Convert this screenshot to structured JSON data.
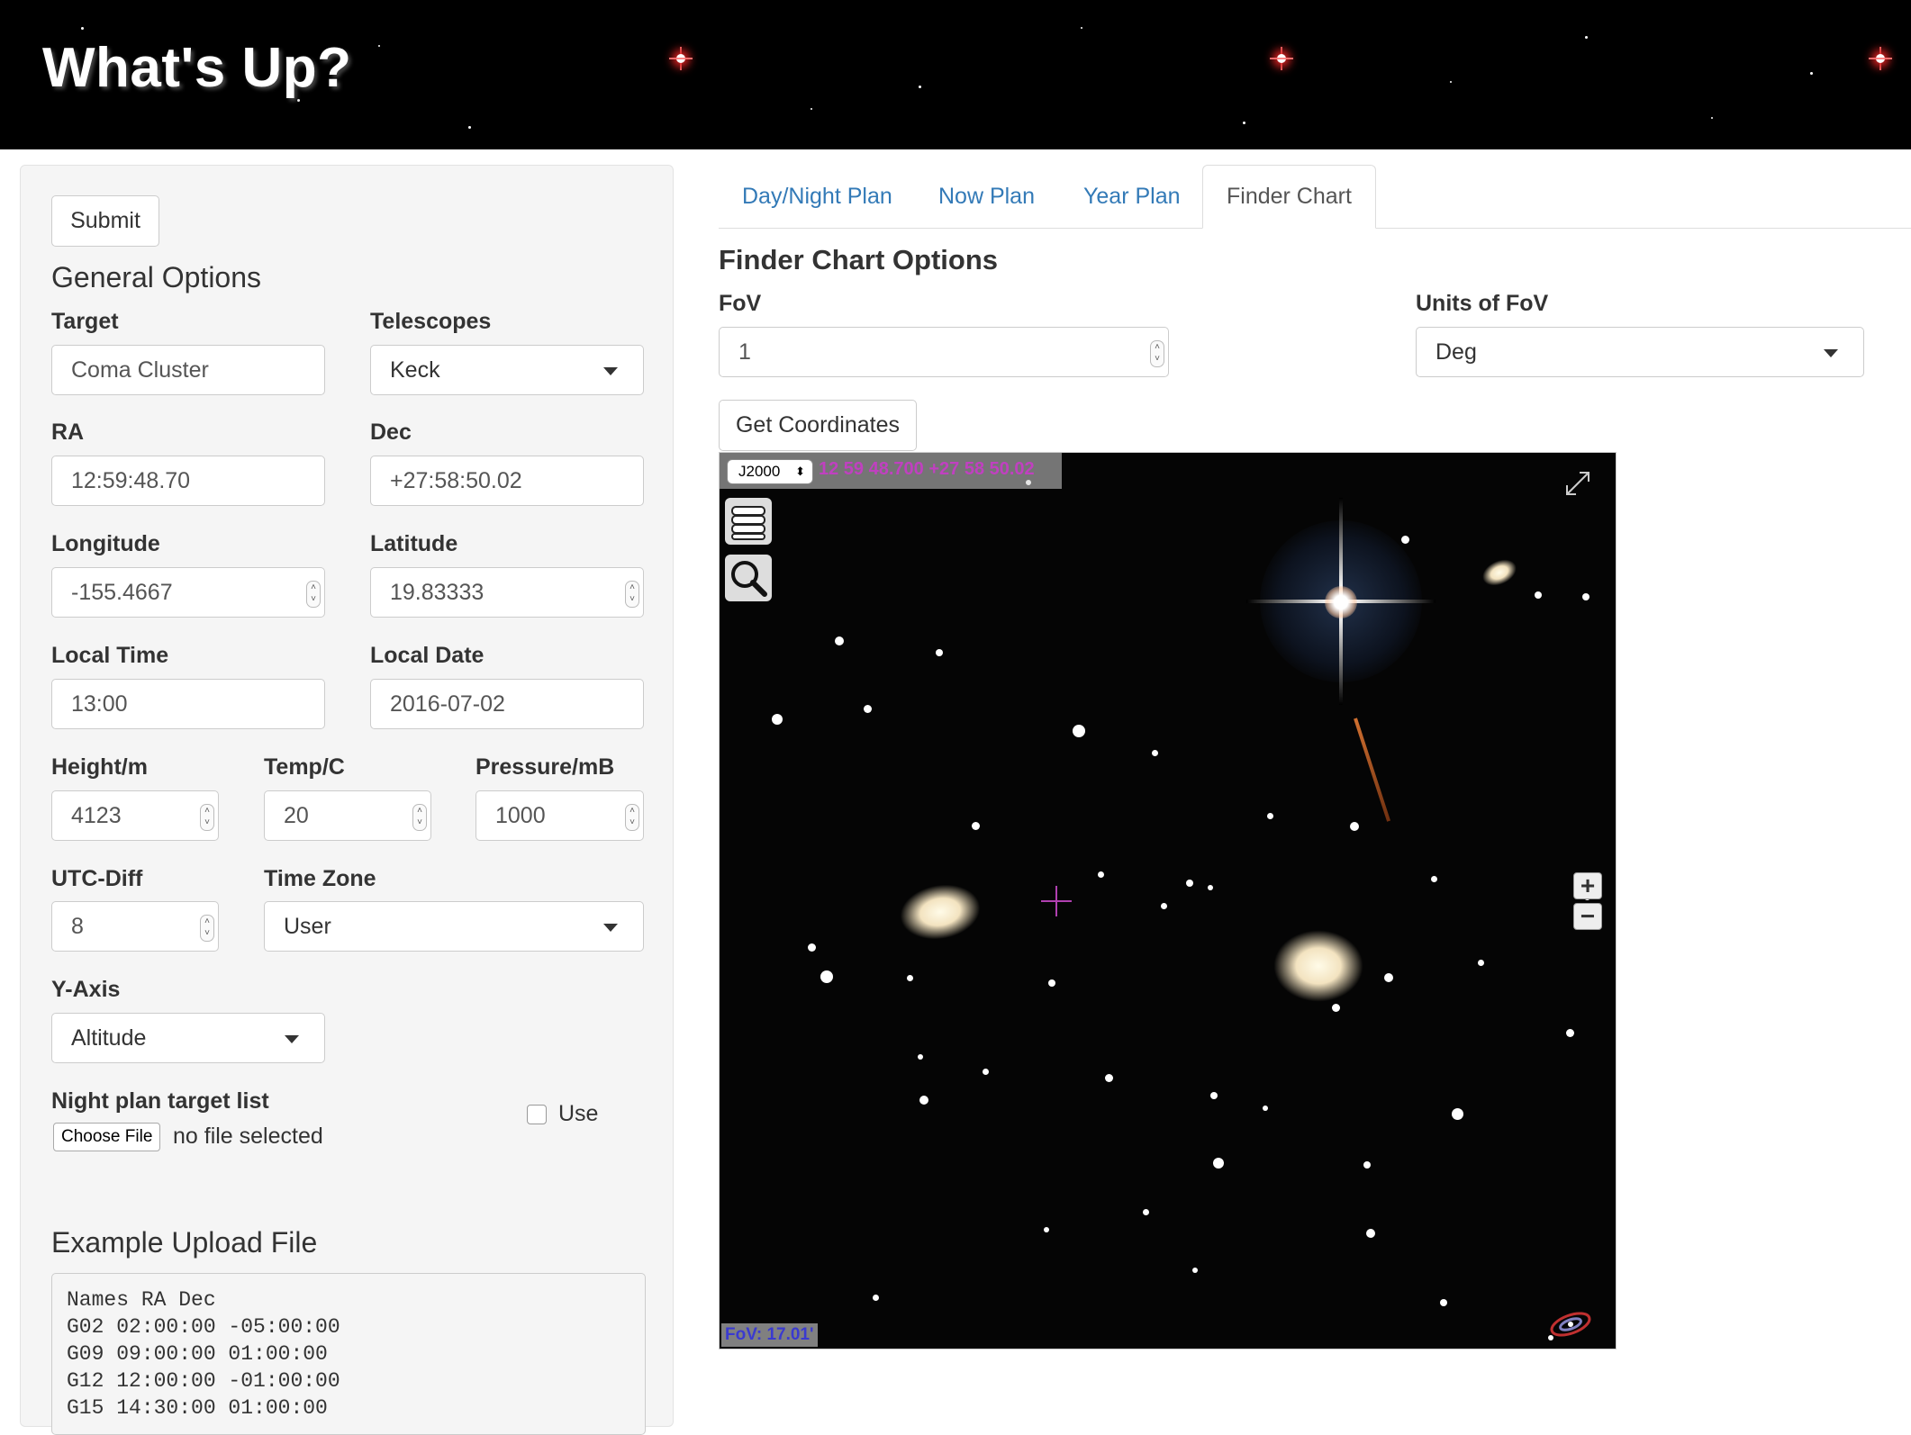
{
  "header": {
    "title": "What's Up?"
  },
  "sidebar": {
    "submit_label": "Submit",
    "general_options_heading": "General Options",
    "target": {
      "label": "Target",
      "value": "Coma Cluster"
    },
    "telescopes": {
      "label": "Telescopes",
      "value": "Keck"
    },
    "ra": {
      "label": "RA",
      "value": "12:59:48.70"
    },
    "dec": {
      "label": "Dec",
      "value": "+27:58:50.02"
    },
    "longitude": {
      "label": "Longitude",
      "value": "-155.4667"
    },
    "latitude": {
      "label": "Latitude",
      "value": "19.83333"
    },
    "local_time": {
      "label": "Local Time",
      "value": "13:00"
    },
    "local_date": {
      "label": "Local Date",
      "value": "2016-07-02"
    },
    "height": {
      "label": "Height/m",
      "value": "4123"
    },
    "temp": {
      "label": "Temp/C",
      "value": "20"
    },
    "pressure": {
      "label": "Pressure/mB",
      "value": "1000"
    },
    "utc_diff": {
      "label": "UTC-Diff",
      "value": "8"
    },
    "time_zone": {
      "label": "Time Zone",
      "value": "User"
    },
    "y_axis": {
      "label": "Y-Axis",
      "value": "Altitude"
    },
    "night_plan": {
      "label": "Night plan target list",
      "choose_file": "Choose File",
      "no_file": "no file selected",
      "use_label": "Use"
    },
    "example_heading": "Example Upload File",
    "example_text": "Names RA Dec\nG02 02:00:00 -05:00:00\nG09 09:00:00 01:00:00\nG12 12:00:00 -01:00:00\nG15 14:30:00 01:00:00"
  },
  "tabs": [
    {
      "label": "Day/Night Plan",
      "active": false
    },
    {
      "label": "Now Plan",
      "active": false
    },
    {
      "label": "Year Plan",
      "active": false
    },
    {
      "label": "Finder Chart",
      "active": true
    }
  ],
  "finder": {
    "heading": "Finder Chart Options",
    "fov": {
      "label": "FoV",
      "value": "1"
    },
    "units": {
      "label": "Units of FoV",
      "value": "Deg"
    },
    "get_coords_label": "Get Coordinates",
    "viewer": {
      "frame": "J2000",
      "coords": "12 59 48.700 +27 58 50.02",
      "fov_text": "FoV: 17.01'"
    }
  },
  "colors": {
    "link": "#337ab7",
    "coord_text": "#c040c0",
    "fov_text": "#3a3ad0"
  }
}
